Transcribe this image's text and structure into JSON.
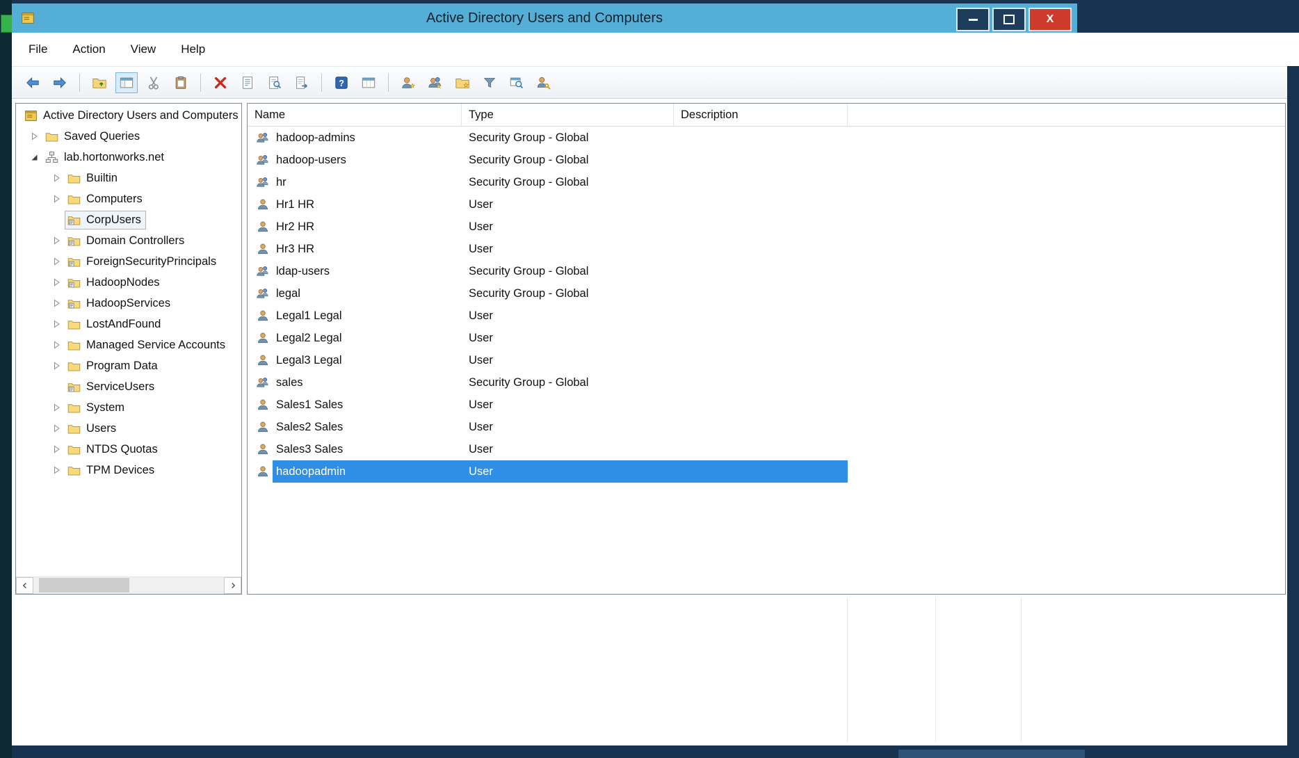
{
  "colors": {
    "desktop": "#17334f",
    "titlebar": "#54aed6",
    "selection": "#2f8fe6",
    "close_button": "#cf3b2a",
    "accent_green": "#36b24a"
  },
  "titlebar": {
    "title": "Active Directory Users and Computers",
    "controls": [
      {
        "name": "minimize"
      },
      {
        "name": "maximize"
      },
      {
        "name": "close",
        "glyph": "X"
      }
    ]
  },
  "menubar": {
    "items": [
      "File",
      "Action",
      "View",
      "Help"
    ]
  },
  "toolbar": {
    "buttons": [
      {
        "icon": "back-icon"
      },
      {
        "icon": "forward-icon"
      },
      {
        "sep": true
      },
      {
        "icon": "up-one-level-icon"
      },
      {
        "icon": "console-tree-icon",
        "pressed": true
      },
      {
        "icon": "cut-icon"
      },
      {
        "icon": "paste-icon"
      },
      {
        "sep": true
      },
      {
        "icon": "delete-icon"
      },
      {
        "icon": "properties-icon"
      },
      {
        "icon": "refresh-icon"
      },
      {
        "icon": "export-list-icon"
      },
      {
        "sep": true
      },
      {
        "icon": "help-icon"
      },
      {
        "icon": "window-icon"
      },
      {
        "sep": true
      },
      {
        "icon": "new-user-icon"
      },
      {
        "icon": "new-group-icon"
      },
      {
        "icon": "new-ou-icon"
      },
      {
        "icon": "filter-icon"
      },
      {
        "icon": "find-icon"
      },
      {
        "icon": "change-user-icon"
      }
    ]
  },
  "tree": {
    "items": [
      {
        "label": "Active Directory Users and Computers",
        "level": 0,
        "icon": "console-icon",
        "arrow": "none"
      },
      {
        "label": "Saved Queries",
        "level": 1,
        "icon": "folder-icon",
        "arrow": "collapsed"
      },
      {
        "label": "lab.hortonworks.net",
        "level": 1,
        "icon": "domain-icon",
        "arrow": "expanded"
      },
      {
        "label": "Builtin",
        "level": 2,
        "icon": "folder-icon",
        "arrow": "collapsed"
      },
      {
        "label": "Computers",
        "level": 2,
        "icon": "folder-icon",
        "arrow": "collapsed"
      },
      {
        "label": "CorpUsers",
        "level": 2,
        "icon": "ou-icon",
        "arrow": "none",
        "selected": true
      },
      {
        "label": "Domain Controllers",
        "level": 2,
        "icon": "ou-icon",
        "arrow": "collapsed"
      },
      {
        "label": "ForeignSecurityPrincipals",
        "level": 2,
        "icon": "ou-icon",
        "arrow": "collapsed"
      },
      {
        "label": "HadoopNodes",
        "level": 2,
        "icon": "ou-icon",
        "arrow": "collapsed"
      },
      {
        "label": "HadoopServices",
        "level": 2,
        "icon": "ou-icon",
        "arrow": "collapsed"
      },
      {
        "label": "LostAndFound",
        "level": 2,
        "icon": "folder-icon",
        "arrow": "collapsed"
      },
      {
        "label": "Managed Service Accounts",
        "level": 2,
        "icon": "folder-icon",
        "arrow": "collapsed"
      },
      {
        "label": "Program Data",
        "level": 2,
        "icon": "folder-icon",
        "arrow": "collapsed"
      },
      {
        "label": "ServiceUsers",
        "level": 2,
        "icon": "ou-icon",
        "arrow": "none"
      },
      {
        "label": "System",
        "level": 2,
        "icon": "folder-icon",
        "arrow": "collapsed"
      },
      {
        "label": "Users",
        "level": 2,
        "icon": "folder-icon",
        "arrow": "collapsed"
      },
      {
        "label": "NTDS Quotas",
        "level": 2,
        "icon": "folder-icon",
        "arrow": "collapsed"
      },
      {
        "label": "TPM Devices",
        "level": 2,
        "icon": "folder-icon",
        "arrow": "collapsed"
      }
    ]
  },
  "list": {
    "columns": [
      "Name",
      "Type",
      "Description"
    ],
    "rows": [
      {
        "icon": "group-icon",
        "name": "hadoop-admins",
        "type": "Security Group - Global",
        "description": ""
      },
      {
        "icon": "group-icon",
        "name": "hadoop-users",
        "type": "Security Group - Global",
        "description": ""
      },
      {
        "icon": "group-icon",
        "name": "hr",
        "type": "Security Group - Global",
        "description": ""
      },
      {
        "icon": "user-icon",
        "name": "Hr1 HR",
        "type": "User",
        "description": ""
      },
      {
        "icon": "user-icon",
        "name": "Hr2 HR",
        "type": "User",
        "description": ""
      },
      {
        "icon": "user-icon",
        "name": "Hr3 HR",
        "type": "User",
        "description": ""
      },
      {
        "icon": "group-icon",
        "name": "ldap-users",
        "type": "Security Group - Global",
        "description": ""
      },
      {
        "icon": "group-icon",
        "name": "legal",
        "type": "Security Group - Global",
        "description": ""
      },
      {
        "icon": "user-icon",
        "name": "Legal1 Legal",
        "type": "User",
        "description": ""
      },
      {
        "icon": "user-icon",
        "name": "Legal2 Legal",
        "type": "User",
        "description": ""
      },
      {
        "icon": "user-icon",
        "name": "Legal3 Legal",
        "type": "User",
        "description": ""
      },
      {
        "icon": "group-icon",
        "name": "sales",
        "type": "Security Group - Global",
        "description": ""
      },
      {
        "icon": "user-icon",
        "name": "Sales1 Sales",
        "type": "User",
        "description": ""
      },
      {
        "icon": "user-icon",
        "name": "Sales2 Sales",
        "type": "User",
        "description": ""
      },
      {
        "icon": "user-icon",
        "name": "Sales3 Sales",
        "type": "User",
        "description": ""
      },
      {
        "icon": "user-icon",
        "name": "hadoopadmin",
        "type": "User",
        "description": "",
        "selected": true
      }
    ]
  }
}
